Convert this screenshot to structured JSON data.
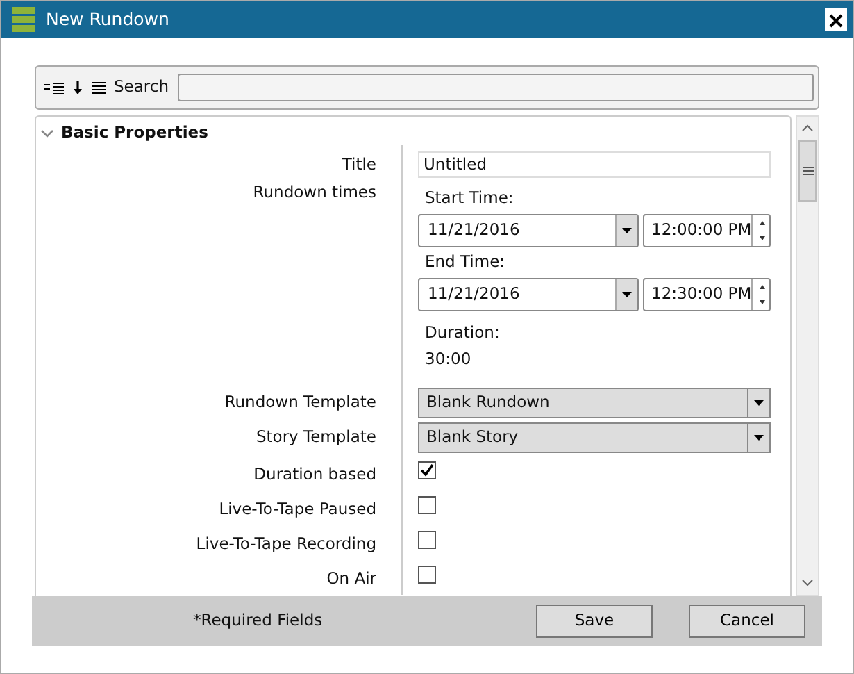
{
  "window": {
    "title": "New Rundown"
  },
  "toolbar": {
    "search_label": "Search"
  },
  "category": {
    "title": "Basic Properties",
    "expanded": true
  },
  "properties": [
    {
      "kind": "text",
      "label": "Title",
      "value": "Untitled"
    },
    {
      "kind": "times",
      "label": "Rundown times",
      "start_label": "Start Time:",
      "start_date": "11/21/2016",
      "start_time": "12:00:00 PM",
      "end_label": "End Time:",
      "end_date": "11/21/2016",
      "end_time": "12:30:00 PM",
      "duration_label": "Duration:",
      "duration": "30:00"
    },
    {
      "kind": "dropdown",
      "label": "Rundown Template",
      "value": "Blank Rundown"
    },
    {
      "kind": "dropdown",
      "label": "Story Template",
      "value": "Blank Story"
    },
    {
      "kind": "checkbox",
      "label": "Duration based",
      "checked": true
    },
    {
      "kind": "checkbox",
      "label": "Live-To-Tape Paused",
      "checked": false
    },
    {
      "kind": "checkbox",
      "label": "Live-To-Tape Recording",
      "checked": false
    },
    {
      "kind": "checkbox",
      "label": "On Air",
      "checked": false
    }
  ],
  "footer": {
    "note": "*Required Fields",
    "buttons": [
      "Save",
      "Cancel"
    ]
  }
}
